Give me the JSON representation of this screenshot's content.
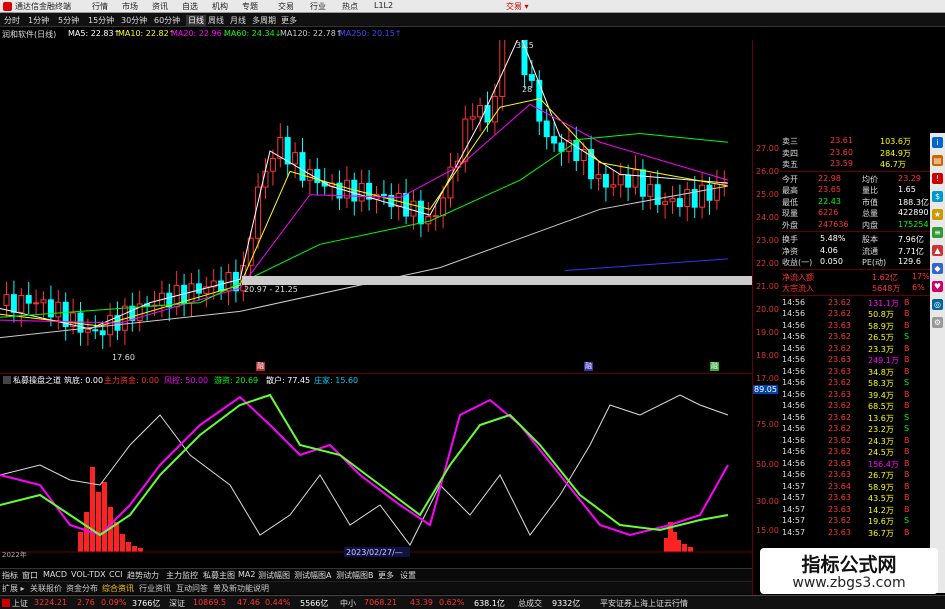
{
  "titlebar": {
    "app_title": "通达信金融终端",
    "menus": [
      "行情",
      "市场",
      "资讯",
      "自选",
      "机构",
      "专题",
      "交易",
      "行业",
      "热点",
      "L1L2"
    ],
    "right_label": "交易 ▾"
  },
  "periods": {
    "items": [
      "分时",
      "1分钟",
      "5分钟",
      "15分钟",
      "30分钟",
      "60分钟",
      "日线",
      "周线",
      "月线",
      "多周期",
      "更多"
    ],
    "active": "日线"
  },
  "ma_row": {
    "stock": "润和软件(日线)",
    "ma5": "MA5: 22.83↑",
    "ma10": "MA10: 22.82↑",
    "ma20": "MA20: 22.96↓",
    "ma60": "MA60: 24.34↓",
    "ma120": "MA120: 22.78↑",
    "ma250": "MA250: 20.15↑"
  },
  "colors": {
    "up": "#ff3333",
    "down": "#00ffff",
    "ma5": "#ffffff",
    "ma10": "#ffff00",
    "ma20": "#ff00ff",
    "ma60": "#00ff00",
    "ma120": "#cccccc",
    "ma250": "#3333ff"
  },
  "main_chart": {
    "high_label": "31.5",
    "low_label": "17.60",
    "range_label": "20.97 - 21.25",
    "mid_label": "28",
    "markers": [
      "融",
      "融",
      "融"
    ],
    "y_ticks": [
      "27.00",
      "26.00",
      "25.00",
      "24.00",
      "23.00",
      "22.00",
      "21.00",
      "20.00",
      "19.00",
      "18.00",
      "17.00"
    ]
  },
  "indicator_row": {
    "name": "私募操盘之道",
    "d1_label": "筑底: 0.00",
    "d2_label": "主力资金: 0.00",
    "d3_label": "风控: 50.00",
    "d4_label": "游资: 20.69",
    "d5_label": "散户: 77.45",
    "d6_label": "庄家: 15.60",
    "right_value": "89.05"
  },
  "indicator_ticks": [
    "75.00",
    "50.00",
    "30.00",
    "15.00"
  ],
  "date_label": "2023/02/27/—",
  "year_label": "2022年",
  "tabs": [
    "指标",
    "窗口",
    "MACD",
    "VOL-TDX",
    "CCI",
    "趋势动力",
    "主力监控",
    "私募主图",
    "MA2",
    "测试幅图",
    "测试幅图A",
    "测试幅图B",
    "更多",
    "设置"
  ],
  "subtabs": [
    "扩展 ▸",
    "关联报价",
    "资金分布",
    "综合资讯",
    "行业资讯",
    "互动问答",
    "普及新功能说明"
  ],
  "status": {
    "sh_name": "上证",
    "sh_value": "3224.21",
    "sh_change": "2.76",
    "sh_pct": "0.09%",
    "sh_amount": "3766亿",
    "sz_name": "深证",
    "sz_value": "10869.5",
    "sz_change": "47.46",
    "sz_pct": "0.44%",
    "sz_amount": "5566亿",
    "zx_name": "中小",
    "zx_value": "7068.21",
    "zx_change": "43.39",
    "zx_pct": "0.62%",
    "zx_amount": "638.1亿",
    "total_label": "总成交",
    "total_value": "9332亿",
    "broker": "平安证券上海上证云行情"
  },
  "quote": {
    "sell_rows": [
      {
        "label": "卖三",
        "price": "23.61",
        "vol": "103.6万"
      },
      {
        "label": "卖四",
        "price": "23.60",
        "vol": "284.9万"
      },
      {
        "label": "卖五",
        "price": "23.59",
        "vol": "46.7万"
      }
    ],
    "info_rows": [
      {
        "l1": "今开",
        "v1": "22.98",
        "l2": "均价",
        "v2": "23.29"
      },
      {
        "l1": "最高",
        "v1": "23.65",
        "l2": "量比",
        "v2": "1.65"
      },
      {
        "l1": "最低",
        "v1": "22.43",
        "l2": "市值",
        "v2": "188.3亿"
      },
      {
        "l1": "现量",
        "v1": "6226",
        "l2": "总量",
        "v2": "422890"
      },
      {
        "l1": "外盘",
        "v1": "247636",
        "l2": "内盘",
        "v2": "175254"
      }
    ],
    "stats_rows": [
      {
        "l1": "换手",
        "v1": "5.48%",
        "l2": "股本",
        "v2": "7.96亿"
      },
      {
        "l1": "净资",
        "v1": "4.06",
        "l2": "流通",
        "v2": "7.71亿"
      },
      {
        "l1": "收益(一)",
        "v1": "0.050",
        "l2": "PE(动)",
        "v2": "129.6"
      }
    ],
    "flow_rows": [
      {
        "label": "净流入额",
        "value": "1.62亿",
        "pct": "17%"
      },
      {
        "label": "大宗流入",
        "value": "5648万",
        "pct": "6%"
      }
    ],
    "ticks": [
      {
        "t": "14:56",
        "p": "23.62",
        "v": "131.1万",
        "s": "B"
      },
      {
        "t": "14:56",
        "p": "23.62",
        "v": "50.8万",
        "s": "B"
      },
      {
        "t": "14:56",
        "p": "23.63",
        "v": "58.9万",
        "s": "B"
      },
      {
        "t": "14:56",
        "p": "23.62",
        "v": "26.5万",
        "s": "S"
      },
      {
        "t": "14:56",
        "p": "23.62",
        "v": "23.3万",
        "s": "B"
      },
      {
        "t": "14:56",
        "p": "23.63",
        "v": "249.1万",
        "s": "B"
      },
      {
        "t": "14:56",
        "p": "23.63",
        "v": "34.8万",
        "s": "B"
      },
      {
        "t": "14:56",
        "p": "23.62",
        "v": "58.3万",
        "s": "S"
      },
      {
        "t": "14:56",
        "p": "23.63",
        "v": "39.4万",
        "s": "B"
      },
      {
        "t": "14:56",
        "p": "23.62",
        "v": "68.5万",
        "s": "B"
      },
      {
        "t": "14:56",
        "p": "23.62",
        "v": "13.6万",
        "s": "S"
      },
      {
        "t": "14:56",
        "p": "23.62",
        "v": "23.2万",
        "s": "S"
      },
      {
        "t": "14:56",
        "p": "23.62",
        "v": "24.3万",
        "s": "B"
      },
      {
        "t": "14:56",
        "p": "23.62",
        "v": "24.5万",
        "s": "B"
      },
      {
        "t": "14:56",
        "p": "23.63",
        "v": "156.4万",
        "s": "B"
      },
      {
        "t": "14:56",
        "p": "23.63",
        "v": "26.7万",
        "s": "B"
      },
      {
        "t": "14:57",
        "p": "23.64",
        "v": "58.9万",
        "s": "B"
      },
      {
        "t": "14:57",
        "p": "23.63",
        "v": "43.5万",
        "s": "B"
      },
      {
        "t": "14:57",
        "p": "23.63",
        "v": "14.2万",
        "s": "B"
      },
      {
        "t": "14:57",
        "p": "23.62",
        "v": "19.6万",
        "s": "S"
      },
      {
        "t": "14:57",
        "p": "23.63",
        "v": "36.7万",
        "s": "B"
      }
    ]
  },
  "watermark": {
    "line1": "指标公式网",
    "line2": "www.zbgs3.com"
  }
}
